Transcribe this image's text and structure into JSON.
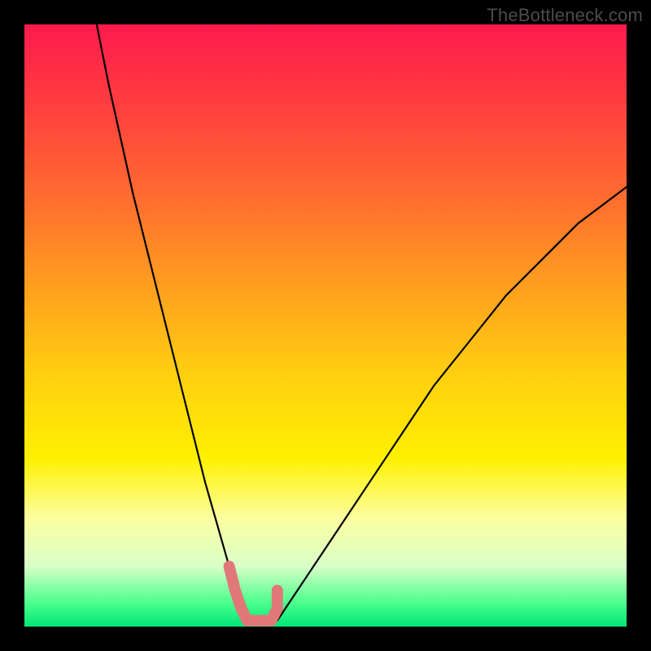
{
  "watermark": "TheBottleneck.com",
  "chart_data": {
    "type": "line",
    "title": "",
    "xlabel": "",
    "ylabel": "",
    "xlim": [
      0,
      100
    ],
    "ylim": [
      0,
      100
    ],
    "grid": false,
    "background_gradient": {
      "top": "#ff1a4d",
      "mid": "#fff000",
      "bottom": "#00e676"
    },
    "annotations": [
      {
        "text": "TheBottleneck.com",
        "pos": "top-right",
        "color": "#4c4c4c"
      }
    ],
    "series": [
      {
        "name": "left-curve",
        "color": "#000000",
        "x": [
          12,
          14,
          16,
          18,
          20,
          22,
          24,
          26,
          28,
          30,
          32,
          34,
          35,
          36,
          37
        ],
        "values": [
          100,
          90,
          81,
          72,
          64,
          56,
          48,
          40,
          32,
          24,
          17,
          10,
          6,
          3,
          1
        ]
      },
      {
        "name": "right-curve",
        "color": "#000000",
        "x": [
          42,
          44,
          46,
          48,
          52,
          56,
          60,
          64,
          68,
          72,
          76,
          80,
          84,
          88,
          92,
          96,
          100
        ],
        "values": [
          1,
          4,
          7,
          10,
          16,
          22,
          28,
          34,
          40,
          45,
          50,
          55,
          59,
          63,
          67,
          70,
          73
        ]
      },
      {
        "name": "valley-marker",
        "color": "#e07878",
        "x": [
          34,
          35,
          36,
          37,
          38,
          39,
          40,
          41,
          42,
          42
        ],
        "values": [
          10,
          6,
          3,
          1,
          1,
          1,
          1,
          1,
          3,
          6
        ]
      }
    ],
    "minimum": {
      "x": 39,
      "y": 1
    }
  }
}
